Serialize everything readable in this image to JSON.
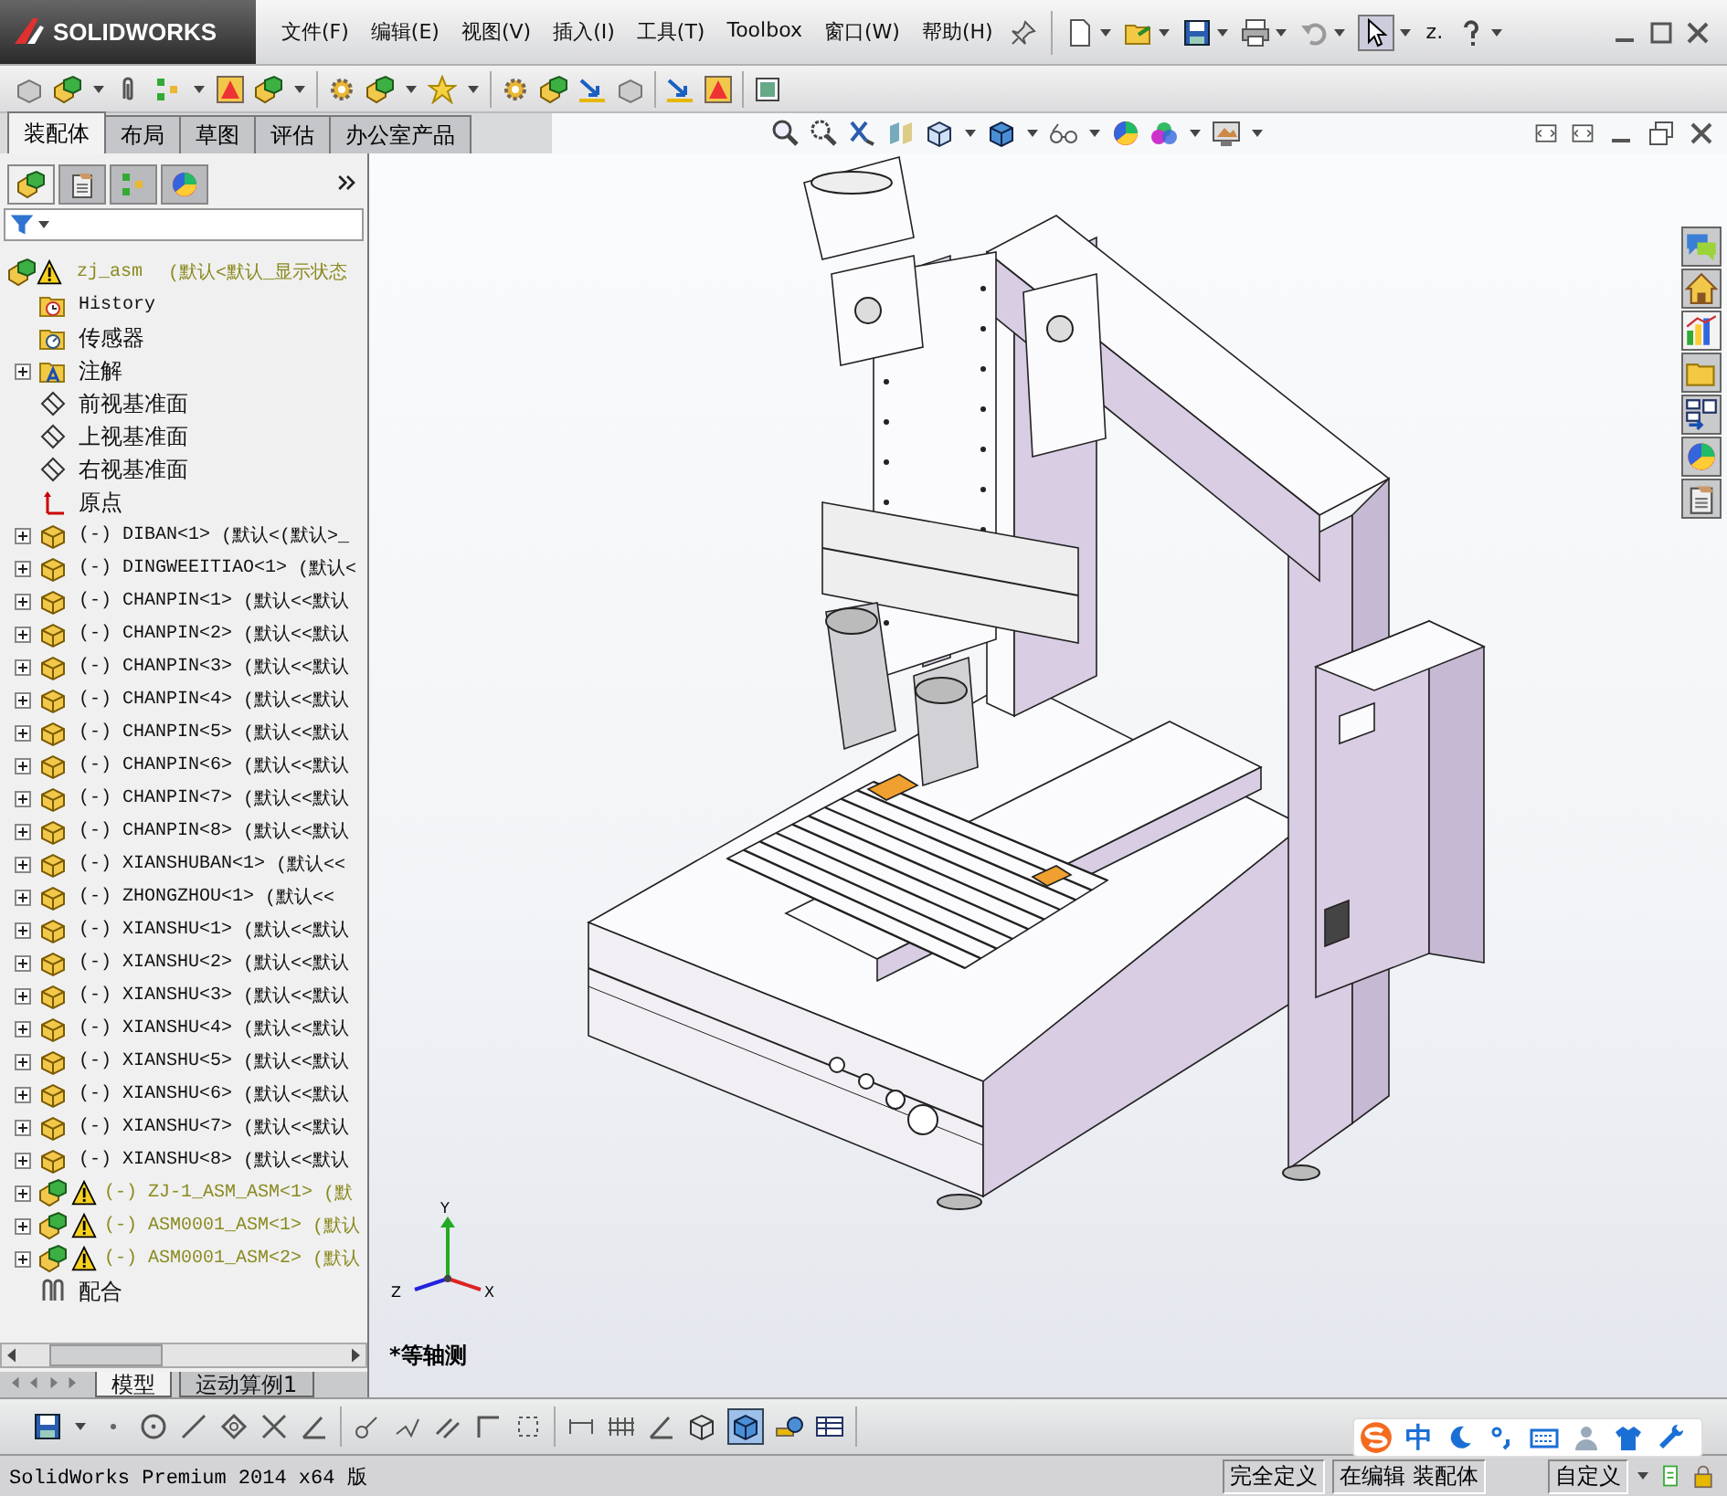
{
  "title_bar": {
    "logo": "SOLIDWORKS",
    "menus": [
      "文件(F)",
      "编辑(E)",
      "视图(V)",
      "插入(I)",
      "工具(T)",
      "Toolbox",
      "窗口(W)",
      "帮助(H)"
    ],
    "search_text": "z."
  },
  "command_tabs": [
    {
      "label": "装配体",
      "selected": true
    },
    {
      "label": "布局",
      "selected": false
    },
    {
      "label": "草图",
      "selected": false
    },
    {
      "label": "评估",
      "selected": false
    },
    {
      "label": "办公室产品",
      "selected": false
    }
  ],
  "tree": {
    "root": {
      "name": "zj_asm",
      "config": "(默认<默认_显示状态",
      "warning": true
    },
    "items": [
      {
        "kind": "history",
        "name": "History",
        "warning": false,
        "expandable": false
      },
      {
        "kind": "sensors",
        "name": "传感器",
        "warning": false,
        "expandable": false
      },
      {
        "kind": "annotations",
        "name": "注解",
        "warning": false,
        "expandable": true
      },
      {
        "kind": "plane",
        "name": "前视基准面",
        "warning": false,
        "expandable": false
      },
      {
        "kind": "plane",
        "name": "上视基准面",
        "warning": false,
        "expandable": false
      },
      {
        "kind": "plane",
        "name": "右视基准面",
        "warning": false,
        "expandable": false
      },
      {
        "kind": "origin",
        "name": "原点",
        "warning": false,
        "expandable": false
      },
      {
        "kind": "part",
        "name": "(-) DIBAN<1>",
        "config": "(默认<(默认>_",
        "warning": false,
        "expandable": true
      },
      {
        "kind": "part",
        "name": "(-) DINGWEEITIAO<1>",
        "config": "(默认<",
        "warning": false,
        "expandable": true
      },
      {
        "kind": "part",
        "name": "(-) CHANPIN<1>",
        "config": "(默认<<默认",
        "warning": false,
        "expandable": true
      },
      {
        "kind": "part",
        "name": "(-) CHANPIN<2>",
        "config": "(默认<<默认",
        "warning": false,
        "expandable": true
      },
      {
        "kind": "part",
        "name": "(-) CHANPIN<3>",
        "config": "(默认<<默认",
        "warning": false,
        "expandable": true
      },
      {
        "kind": "part",
        "name": "(-) CHANPIN<4>",
        "config": "(默认<<默认",
        "warning": false,
        "expandable": true
      },
      {
        "kind": "part",
        "name": "(-) CHANPIN<5>",
        "config": "(默认<<默认",
        "warning": false,
        "expandable": true
      },
      {
        "kind": "part",
        "name": "(-) CHANPIN<6>",
        "config": "(默认<<默认",
        "warning": false,
        "expandable": true
      },
      {
        "kind": "part",
        "name": "(-) CHANPIN<7>",
        "config": "(默认<<默认",
        "warning": false,
        "expandable": true
      },
      {
        "kind": "part",
        "name": "(-) CHANPIN<8>",
        "config": "(默认<<默认",
        "warning": false,
        "expandable": true
      },
      {
        "kind": "part",
        "name": "(-) XIANSHUBAN<1>",
        "config": "(默认<<",
        "warning": false,
        "expandable": true
      },
      {
        "kind": "part",
        "name": "(-) ZHONGZHOU<1>",
        "config": "(默认<<",
        "warning": false,
        "expandable": true
      },
      {
        "kind": "part",
        "name": "(-) XIANSHU<1>",
        "config": "(默认<<默认",
        "warning": false,
        "expandable": true
      },
      {
        "kind": "part",
        "name": "(-) XIANSHU<2>",
        "config": "(默认<<默认",
        "warning": false,
        "expandable": true
      },
      {
        "kind": "part",
        "name": "(-) XIANSHU<3>",
        "config": "(默认<<默认",
        "warning": false,
        "expandable": true
      },
      {
        "kind": "part",
        "name": "(-) XIANSHU<4>",
        "config": "(默认<<默认",
        "warning": false,
        "expandable": true
      },
      {
        "kind": "part",
        "name": "(-) XIANSHU<5>",
        "config": "(默认<<默认",
        "warning": false,
        "expandable": true
      },
      {
        "kind": "part",
        "name": "(-) XIANSHU<6>",
        "config": "(默认<<默认",
        "warning": false,
        "expandable": true
      },
      {
        "kind": "part",
        "name": "(-) XIANSHU<7>",
        "config": "(默认<<默认",
        "warning": false,
        "expandable": true
      },
      {
        "kind": "part",
        "name": "(-) XIANSHU<8>",
        "config": "(默认<<默认",
        "warning": false,
        "expandable": true
      },
      {
        "kind": "subassembly",
        "name": "(-) ZJ-1_ASM_ASM<1>",
        "config": "(默",
        "warning": true,
        "expandable": true
      },
      {
        "kind": "subassembly",
        "name": "(-) ASM0001_ASM<1>",
        "config": "(默认",
        "warning": true,
        "expandable": true
      },
      {
        "kind": "subassembly",
        "name": "(-) ASM0001_ASM<2>",
        "config": "(默认",
        "warning": true,
        "expandable": true
      },
      {
        "kind": "mates",
        "name": "配合",
        "warning": false,
        "expandable": false
      }
    ]
  },
  "bottom_tabs": [
    {
      "label": "模型",
      "selected": true
    },
    {
      "label": "运动算例1",
      "selected": false
    }
  ],
  "viewport": {
    "view_label": "*等轴测",
    "triad": {
      "x": "X",
      "y": "Y",
      "z": "Z"
    }
  },
  "status_bar": {
    "product": "SolidWorks Premium 2014 x64 版",
    "cells": [
      "完全定义",
      "在编辑 装配体",
      "自定义"
    ]
  },
  "ime": {
    "mode": "中"
  }
}
